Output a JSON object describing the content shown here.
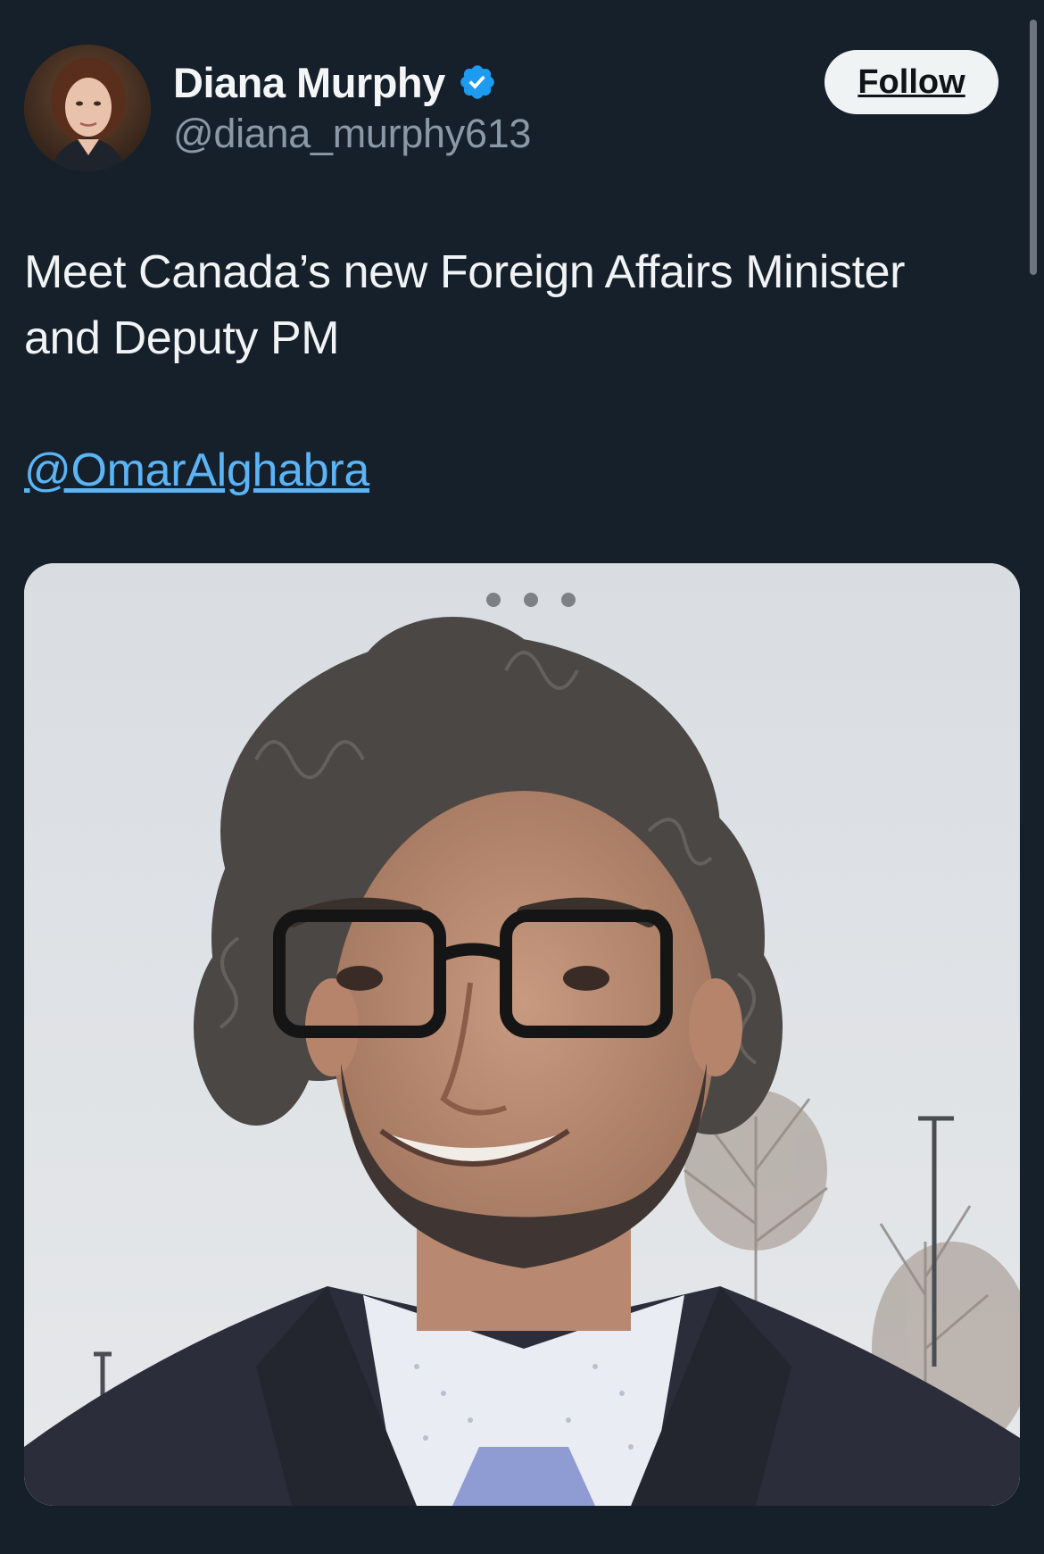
{
  "author": {
    "display_name": "Diana Murphy",
    "handle": "@diana_murphy613",
    "verified": true,
    "avatar_icon": "profile-photo"
  },
  "follow_label": "Follow",
  "tweet": {
    "text_line1": "Meet Canada’s new Foreign Affairs Minister",
    "text_line2": "and Deputy PM",
    "mention": "@OmarAlghabra"
  },
  "media": {
    "type": "photo",
    "more_icon": "ellipsis-icon"
  },
  "colors": {
    "background": "#15202b",
    "verified_blue": "#1d9bf0",
    "link_blue": "#5ab4f5",
    "follow_button": "#eff3f4"
  }
}
